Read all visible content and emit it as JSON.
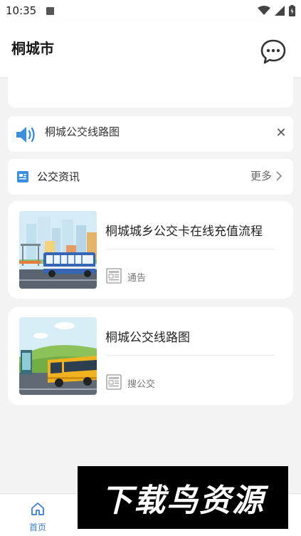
{
  "status_bar": {
    "time": "10:35"
  },
  "header": {
    "title": "桐城市"
  },
  "notice": {
    "text": "桐城公交线路图"
  },
  "news_section": {
    "title": "公交资讯",
    "more_label": "更多"
  },
  "news": [
    {
      "title": "桐城城乡公交卡在线充值流程",
      "source": "通告"
    },
    {
      "title": "桐城公交线路图",
      "source": "搜公交"
    }
  ],
  "tab_bar": {
    "home_label": "首页"
  },
  "watermark": {
    "text": "下载鸟资源"
  },
  "colors": {
    "accent": "#3a7fd6",
    "speaker": "#3b8fe0",
    "background": "#f3f3f3"
  }
}
